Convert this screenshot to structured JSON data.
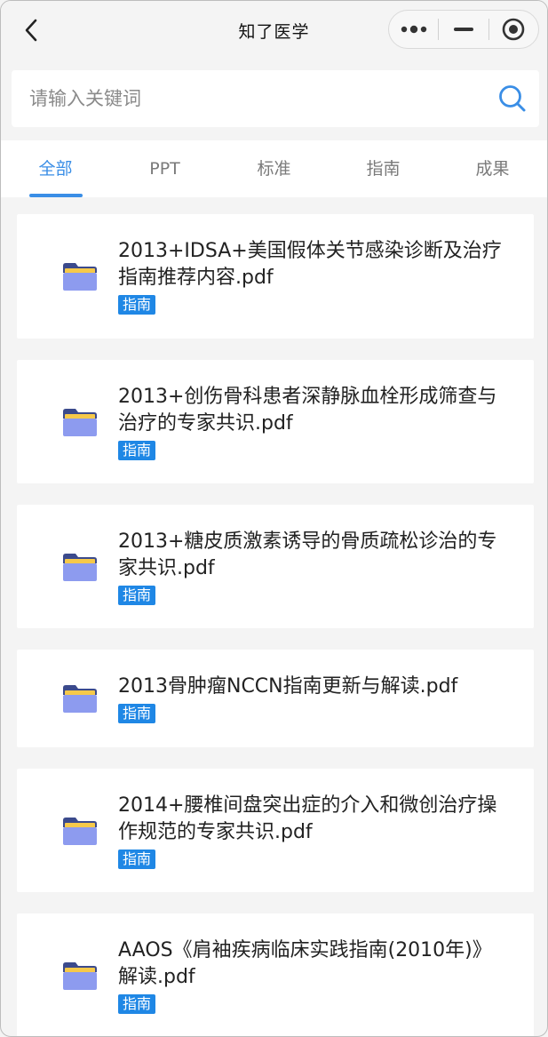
{
  "navbar": {
    "title": "知了医学",
    "back_icon": "chevron-left-icon",
    "more_icon": "more-dots-icon",
    "minimize_icon": "minimize-icon",
    "close_icon": "target-circle-icon"
  },
  "search": {
    "placeholder": "请输入关键词",
    "value": "",
    "icon": "search-icon"
  },
  "tabs": [
    {
      "label": "全部",
      "active": true
    },
    {
      "label": "PPT",
      "active": false
    },
    {
      "label": "标准",
      "active": false
    },
    {
      "label": "指南",
      "active": false
    },
    {
      "label": "成果",
      "active": false
    }
  ],
  "colors": {
    "accent": "#3a8ee6",
    "tag_bg": "#1f87e5",
    "folder_body": "#8d9bef",
    "folder_tab": "#f6c94a",
    "background": "#f4f4f4"
  },
  "documents": [
    {
      "title": "2013+IDSA+美国假体关节感染诊断及治疗指南推荐内容.pdf",
      "tag": "指南",
      "icon": "folder-icon"
    },
    {
      "title": "2013+创伤骨科患者深静脉血栓形成筛查与治疗的专家共识.pdf",
      "tag": "指南",
      "icon": "folder-icon"
    },
    {
      "title": "2013+糖皮质激素诱导的骨质疏松诊治的专家共识.pdf",
      "tag": "指南",
      "icon": "folder-icon"
    },
    {
      "title": "2013骨肿瘤NCCN指南更新与解读.pdf",
      "tag": "指南",
      "icon": "folder-icon"
    },
    {
      "title": "2014+腰椎间盘突出症的介入和微创治疗操作规范的专家共识.pdf",
      "tag": "指南",
      "icon": "folder-icon"
    },
    {
      "title": "AAOS《肩袖疾病临床实践指南(2010年)》解读.pdf",
      "tag": "指南",
      "icon": "folder-icon"
    }
  ]
}
